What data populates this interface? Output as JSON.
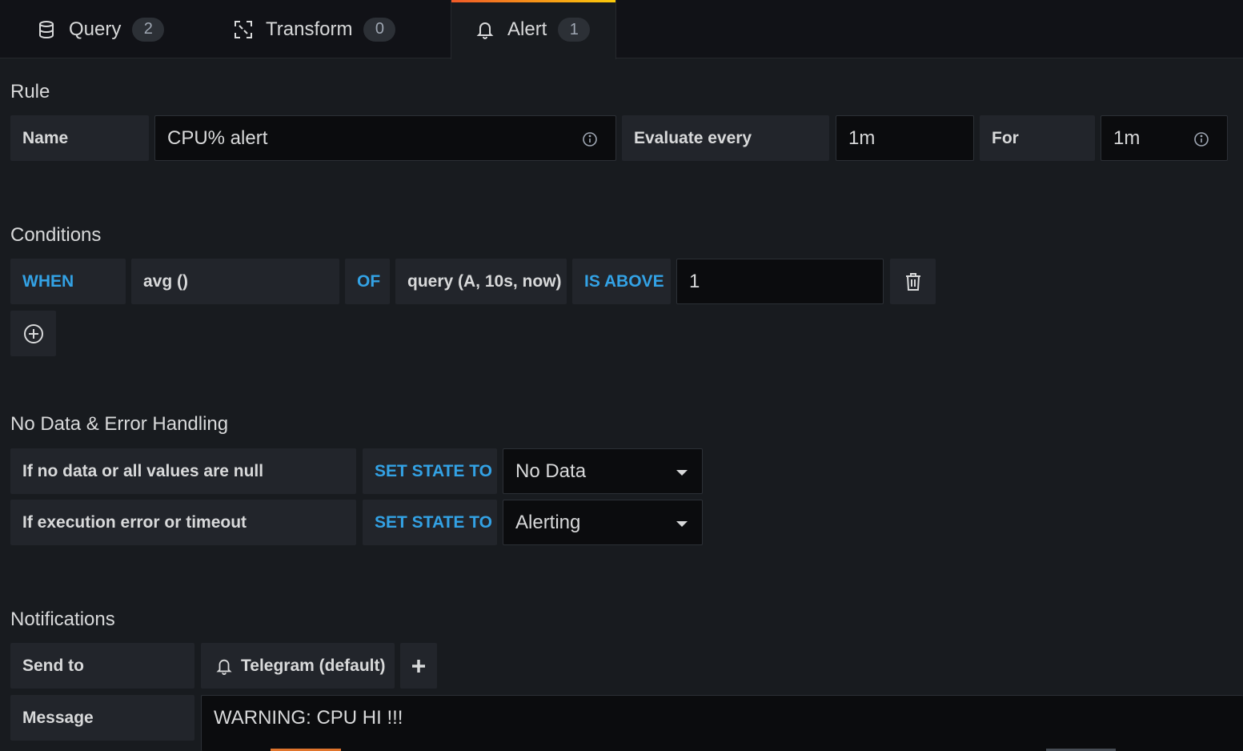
{
  "tabs": [
    {
      "label": "Query",
      "count": "2",
      "icon": "database-icon"
    },
    {
      "label": "Transform",
      "count": "0",
      "icon": "transform-icon"
    },
    {
      "label": "Alert",
      "count": "1",
      "icon": "bell-icon",
      "active": true
    }
  ],
  "colors": {
    "background": "#181b1f",
    "tabbar": "#111217",
    "label_bg": "#22252b",
    "input_bg": "#0b0c0e",
    "keyword": "#33a2e5",
    "active_tab_gradient_start": "#f05a28",
    "active_tab_gradient_end": "#fbca0a"
  },
  "rule": {
    "heading": "Rule",
    "name_label": "Name",
    "name_value": "CPU% alert",
    "evaluate_label": "Evaluate every",
    "evaluate_value": "1m",
    "for_label": "For",
    "for_value": "1m"
  },
  "conditions": {
    "heading": "Conditions",
    "when": "WHEN",
    "reducer": "avg ()",
    "of": "OF",
    "query": "query (A, 10s, now)",
    "evaluator": "IS ABOVE",
    "threshold": "1"
  },
  "nodata": {
    "heading": "No Data & Error Handling",
    "rows": [
      {
        "label": "If no data or all values are null",
        "keyword": "SET STATE TO",
        "value": "No Data"
      },
      {
        "label": "If execution error or timeout",
        "keyword": "SET STATE TO",
        "value": "Alerting"
      }
    ]
  },
  "notifications": {
    "heading": "Notifications",
    "send_to_label": "Send to",
    "channel": "Telegram (default)",
    "message_label": "Message",
    "message_value": "WARNING: CPU HI !!!"
  }
}
